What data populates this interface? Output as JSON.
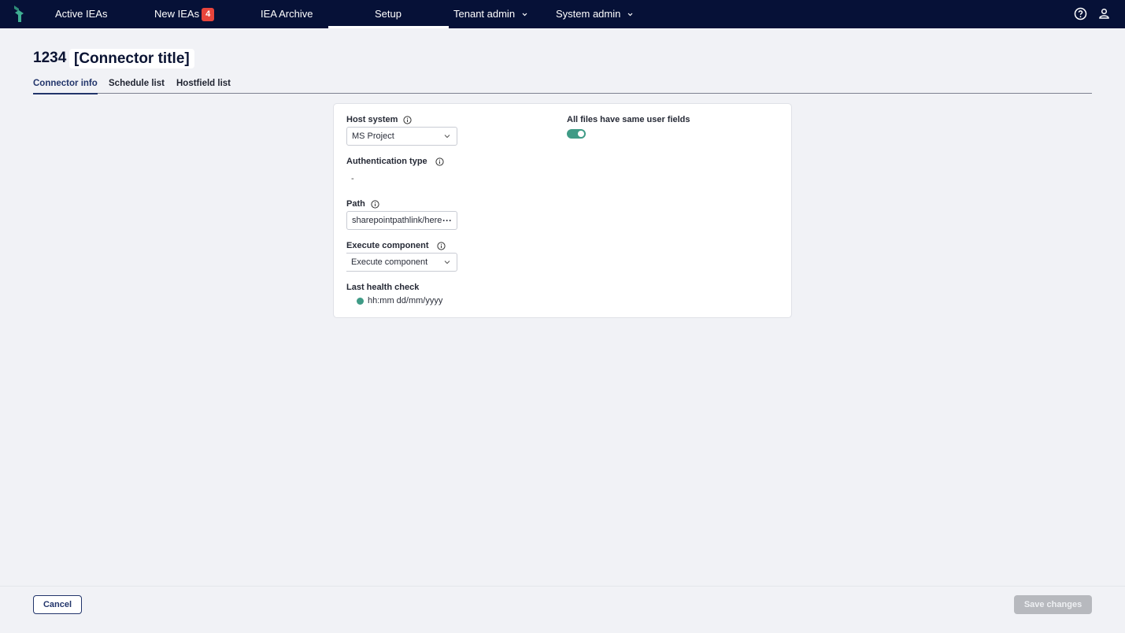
{
  "nav": {
    "items": [
      {
        "label": "Active IEAs"
      },
      {
        "label": "New IEAs",
        "badge": "4"
      },
      {
        "label": "IEA Archive"
      },
      {
        "label": "Setup",
        "active": true
      },
      {
        "label": "Tenant admin",
        "dropdown": true
      },
      {
        "label": "System admin",
        "dropdown": true
      }
    ],
    "icons": [
      "help-icon",
      "user-icon"
    ],
    "colors": {
      "background": "#061137",
      "badge": "#e8453c"
    }
  },
  "header": {
    "id": "1234",
    "title": "[Connector title]"
  },
  "tabs": [
    {
      "label": "Connector info",
      "active": true
    },
    {
      "label": "Schedule list"
    },
    {
      "label": "Hostfield list"
    }
  ],
  "form": {
    "host_system": {
      "label": "Host system",
      "value": "MS Project"
    },
    "authentication_type": {
      "label": "Authentication type",
      "value": "-"
    },
    "path": {
      "label": "Path",
      "value": "sharepointpathlink/here"
    },
    "execute_component": {
      "label": "Execute  component",
      "value": "Execute component"
    },
    "last_health_check": {
      "label": "Last health check",
      "value": "hh:mm dd/mm/yyyy",
      "status_color": "#3f9b86"
    },
    "same_user_fields": {
      "label": "All files have same user fields",
      "enabled": true
    }
  },
  "footer": {
    "cancel_label": "Cancel",
    "save_label": "Save changes"
  }
}
